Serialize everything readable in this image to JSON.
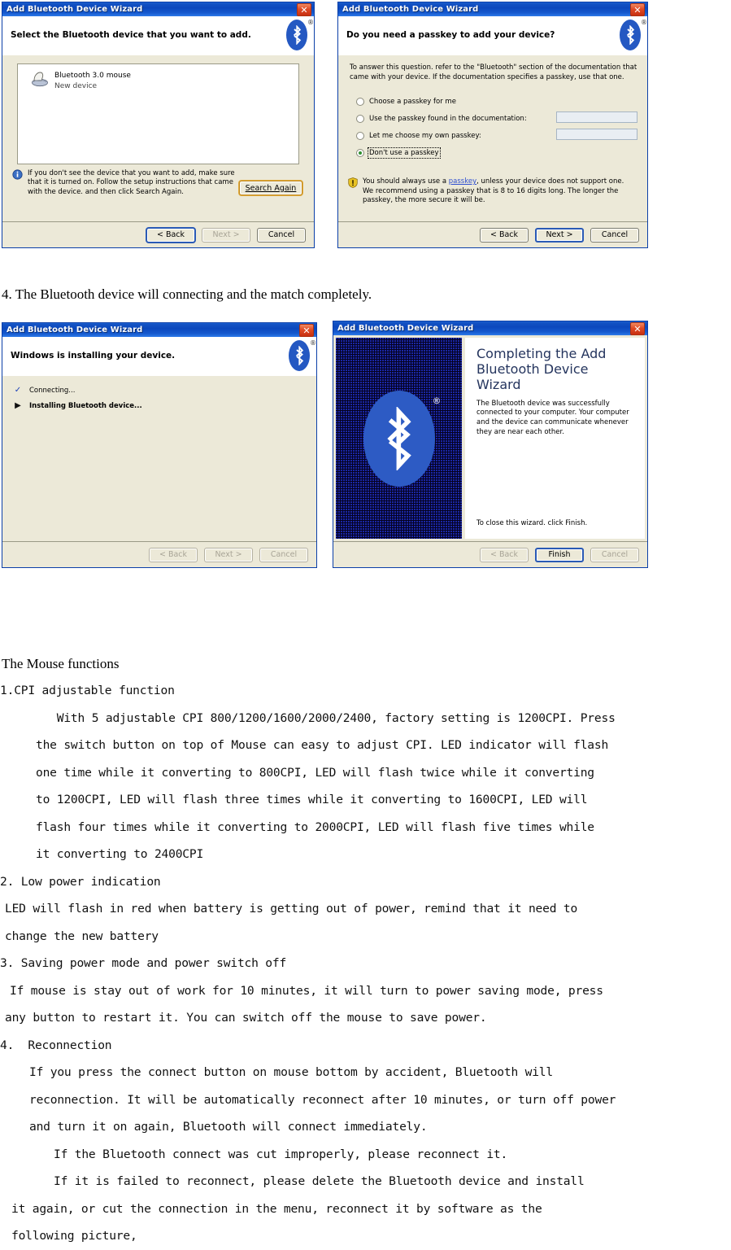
{
  "dialogs": {
    "common": {
      "title": "Add Bluetooth Device Wizard",
      "close_icon": "close-icon",
      "bluetooth_icon": "bluetooth-logo-icon",
      "registered_mark": "®",
      "back_label": "< Back",
      "next_label": "Next >",
      "cancel_label": "Cancel",
      "finish_label": "Finish"
    },
    "select_device": {
      "heading": "Select the Bluetooth device that you want to add.",
      "device": {
        "icon": "mouse-icon",
        "name": "Bluetooth 3.0 mouse",
        "status": "New device"
      },
      "note_icon": "info-icon",
      "note": "If you don't see the device that you want to add, make sure that it is turned on. Follow the setup instructions that came with the device. and then click Search Again.",
      "search_again_label": "Search Again"
    },
    "passkey": {
      "heading": "Do you need a passkey to add your device?",
      "intro": "To answer this question. refer to the \"Bluetooth\" section of the documentation that came with your device. If the documentation specifies a passkey, use that one.",
      "options": [
        {
          "label": "Choose a passkey for me",
          "selected": false,
          "has_input": false,
          "input_value": ""
        },
        {
          "label": "Use the passkey found in the documentation:",
          "selected": false,
          "has_input": true,
          "input_value": ""
        },
        {
          "label": "Let me choose my own passkey:",
          "selected": false,
          "has_input": true,
          "input_value": ""
        },
        {
          "label": "Don't use a passkey",
          "selected": true,
          "has_input": false,
          "input_value": ""
        }
      ],
      "warn_icon": "shield-warning-icon",
      "warn_pre": "You should always use a ",
      "warn_link": "passkey",
      "warn_post": ", unless your device does not support one. We recommend using a passkey that is 8 to 16 digits long. The longer the passkey, the more secure it will be."
    },
    "installing": {
      "heading": "Windows is installing your device.",
      "steps": [
        {
          "mark_icon": "check-icon",
          "label": "Connecting...",
          "done": true
        },
        {
          "mark_icon": "arrow-right-icon",
          "label": "Installing Bluetooth device...",
          "done": false
        }
      ]
    },
    "completing": {
      "heading": "Completing the Add Bluetooth Device Wizard",
      "body": "The Bluetooth device was successfully connected to your computer. Your computer and the device can communicate whenever they are near each other.",
      "footer": "To close this wizard. click Finish."
    }
  },
  "document": {
    "caption_step4": "4. The Bluetooth device will connecting and the match completely.",
    "section_title": "The Mouse functions",
    "items": [
      {
        "number": "1.",
        "title": "CPI adjustable function",
        "lines": [
          "   With 5 adjustable CPI 800/1200/1600/2000/2400, factory setting is 1200CPI. Press",
          "the switch button on top of Mouse can easy to adjust CPI. LED indicator will flash",
          "one time while it converting to 800CPI, LED will flash twice while it converting",
          "to 1200CPI, LED will flash three times while it converting to 1600CPI, LED will",
          "flash four times while it converting to 2000CPI, LED will flash five times while",
          "it converting to 2400CPI"
        ]
      },
      {
        "number": "2.",
        "title": " Low power indication",
        "lines": [
          "LED will flash in red when battery is getting out of power, remind that it need to",
          "change the new battery"
        ]
      },
      {
        "number": "3.",
        "title": " Saving power mode and power switch off",
        "lines": [
          "If mouse is stay out of work for 10 minutes, it will turn to power saving mode, press",
          "any button to restart it. You can switch off the mouse to save power."
        ]
      },
      {
        "number": "4.",
        "title": "  Reconnection",
        "lines": [
          "If you press the connect button on mouse bottom by accident, Bluetooth will",
          "reconnection. It will be automatically reconnect after 10 minutes, or turn off power",
          "and turn it on again, Bluetooth will connect immediately.",
          "If the Bluetooth connect was cut improperly, please reconnect it.",
          "If it is failed to reconnect, please delete the Bluetooth device and install",
          "it again, or cut the connection in the menu, reconnect it by software as the",
          "following picture,"
        ]
      }
    ]
  }
}
